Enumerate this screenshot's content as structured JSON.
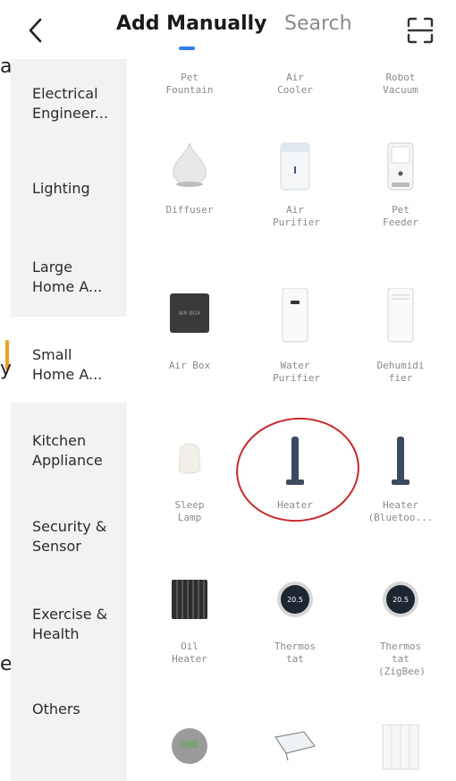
{
  "edge_fragments": [
    "e",
    "a",
    "y",
    "e"
  ],
  "header": {
    "active_tab": "Add Manually",
    "search_tab": "Search"
  },
  "sidebar": {
    "items": [
      {
        "label": "Electrical Engineer..."
      },
      {
        "label": "Lighting"
      },
      {
        "label": "Large Home A..."
      },
      {
        "label": "Small Home A...",
        "active": true
      },
      {
        "label": "Kitchen Appliance"
      },
      {
        "label": "Security & Sensor"
      },
      {
        "label": "Exercise & Health"
      },
      {
        "label": "Others"
      }
    ]
  },
  "devices": [
    {
      "name": "Pet Fountain"
    },
    {
      "name": "Air Cooler"
    },
    {
      "name": "Robot Vacuum"
    },
    {
      "name": "Diffuser"
    },
    {
      "name": "Air Purifier"
    },
    {
      "name": "Pet Feeder"
    },
    {
      "name": "Air Box"
    },
    {
      "name": "Water Purifier"
    },
    {
      "name": "Dehumidi fier"
    },
    {
      "name": "Sleep Lamp"
    },
    {
      "name": "Heater"
    },
    {
      "name": "Heater (Bluetoo..."
    },
    {
      "name": "Oil Heater"
    },
    {
      "name": "Thermos tat"
    },
    {
      "name": "Thermos tat (ZigBee)"
    }
  ],
  "device_labels": {
    "air_box": "AIR BOX",
    "thermostat": "20.5",
    "thermostat_zigbee": "20.5"
  },
  "colors": {
    "accent_blue": "#2f7cf6",
    "highlight_red": "#c8282c",
    "sidebar_bg": "#f2f2f2",
    "edge_accent": "#f0a020"
  }
}
